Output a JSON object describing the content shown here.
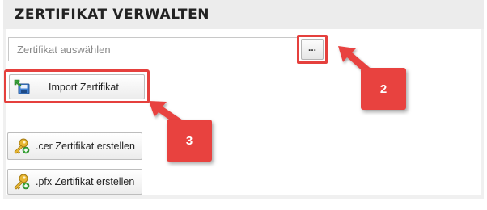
{
  "panel": {
    "title": "ZERTIFIKAT VERWALTEN"
  },
  "certificate_field": {
    "value": "",
    "placeholder": "Zertifikat auswählen"
  },
  "browse_button": {
    "label": "..."
  },
  "buttons": {
    "import_label": "Import Zertifikat",
    "cer_label": ".cer Zertifikat erstellen",
    "pfx_label": ".pfx Zertifikat erstellen"
  },
  "icons": {
    "import": "import-certificate-icon",
    "cer": "key-create-icon",
    "pfx": "key-create-icon"
  },
  "annotations": {
    "callout_2": "2",
    "callout_3": "3",
    "color": "#e5403d"
  }
}
